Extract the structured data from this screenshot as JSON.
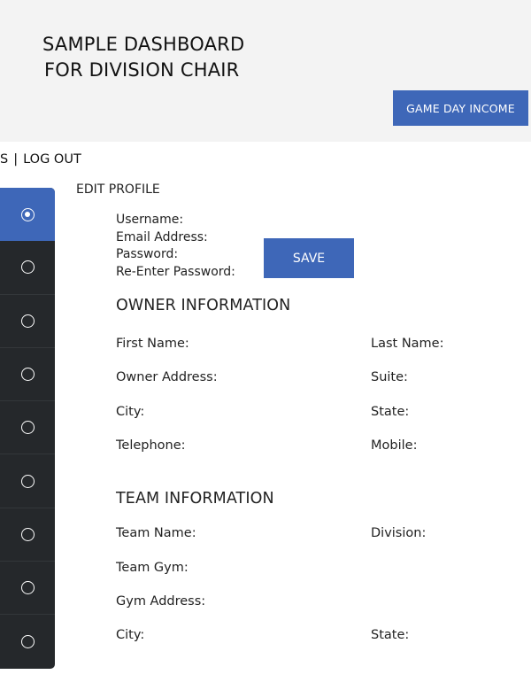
{
  "header": {
    "title_line1": "SAMPLE DASHBOARD",
    "title_line2": "FOR DIVISION CHAIR",
    "game_day_button": "GAME DAY INCOME"
  },
  "topnav": {
    "cut_link": "S",
    "separator": "|",
    "logout": "LOG OUT"
  },
  "sidebar": {
    "items": [
      {
        "icon": "radio-selected-icon",
        "active": true
      },
      {
        "icon": "radio-icon",
        "active": false
      },
      {
        "icon": "radio-icon",
        "active": false
      },
      {
        "icon": "radio-icon",
        "active": false
      },
      {
        "icon": "radio-icon",
        "active": false
      },
      {
        "icon": "radio-icon",
        "active": false
      },
      {
        "icon": "radio-icon",
        "active": false
      },
      {
        "icon": "radio-icon",
        "active": false
      },
      {
        "icon": "radio-icon",
        "active": false
      }
    ]
  },
  "edit_profile": {
    "label": "EDIT PROFILE",
    "username": "Username:",
    "email": "Email Address:",
    "password": "Password:",
    "reenter": "Re-Enter Password:",
    "save": "SAVE"
  },
  "owner": {
    "heading": "OWNER INFORMATION",
    "first_name": "First Name:",
    "last_name": "Last Name:",
    "address": "Owner Address:",
    "suite": "Suite:",
    "city": "City:",
    "state": "State:",
    "telephone": "Telephone:",
    "mobile": "Mobile:"
  },
  "team": {
    "heading": "TEAM INFORMATION",
    "team_name": "Team Name:",
    "division": "Division:",
    "team_gym": "Team Gym:",
    "gym_address": "Gym Address:",
    "city": "City:",
    "state": "State:"
  },
  "colors": {
    "accent": "#3e67b8",
    "sidebar": "#25282b",
    "header_bg": "#f3f3f3"
  }
}
